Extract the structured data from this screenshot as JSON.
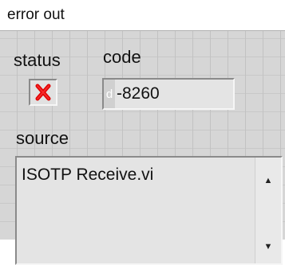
{
  "cluster": {
    "title": "error out",
    "status_label": "status",
    "code_label": "code",
    "source_label": "source",
    "status": {
      "value": false,
      "icon": "red-x-icon",
      "color": "#e00000"
    },
    "code": {
      "radix": "d",
      "value": "-8260"
    },
    "source": {
      "value": "ISOTP Receive.vi"
    },
    "scrollbar": {
      "up_glyph": "▲",
      "down_glyph": "▼"
    }
  }
}
